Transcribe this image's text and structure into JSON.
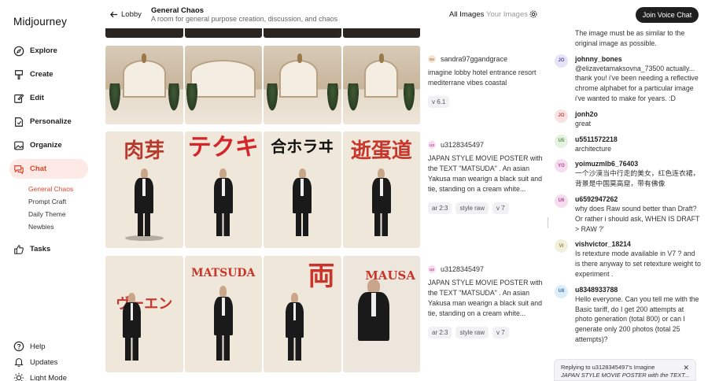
{
  "sidebar": {
    "logo": "Midjourney",
    "items": [
      {
        "label": "Explore",
        "icon": "compass-icon"
      },
      {
        "label": "Create",
        "icon": "paintbrush-icon"
      },
      {
        "label": "Edit",
        "icon": "edit-icon"
      },
      {
        "label": "Personalize",
        "icon": "personalize-icon"
      },
      {
        "label": "Organize",
        "icon": "image-icon"
      },
      {
        "label": "Chat",
        "icon": "chat-icon"
      },
      {
        "label": "Tasks",
        "icon": "thumbs-up-icon"
      }
    ],
    "chat_rooms": [
      "General Chaos",
      "Prompt Craft",
      "Daily Theme",
      "Newbies"
    ],
    "active_room": "General Chaos",
    "bottom": [
      {
        "label": "Help",
        "icon": "help-icon"
      },
      {
        "label": "Updates",
        "icon": "bell-icon"
      },
      {
        "label": "Light Mode",
        "icon": "sun-icon"
      }
    ]
  },
  "header": {
    "back_label": "Lobby",
    "room_title": "General Chaos",
    "room_subtitle": "A room for general purpose creation, discussion, and chaos",
    "tab_all": "All Images",
    "tab_your": "Your Images",
    "join_voice": "Join Voice Chat"
  },
  "posts": [
    {
      "avatar": "SA",
      "avatar_color": "#f3e6d4",
      "user": "sandra97ggandgrace",
      "prompt": "imagine lobby hotel entrance resort mediterrane vibes coastal",
      "tags": [
        "v 6.1"
      ]
    },
    {
      "avatar": "U3",
      "avatar_color": "#f6dcef",
      "user": "u3128345497",
      "prompt": "JAPAN STYLE MOVIE POSTER with the TEXT \"MATSUDA\" . An asian Yakusa man wearign a black suit and tie, standing on a cream white...",
      "tags": [
        "ar 2:3",
        "style raw",
        "v 7"
      ],
      "poster_text": [
        "肉芽",
        "テクキ",
        "合ホラヰ",
        "逝蛋道"
      ]
    },
    {
      "avatar": "U3",
      "avatar_color": "#f6dcef",
      "user": "u3128345497",
      "prompt": "JAPAN STYLE MOVIE POSTER with the TEXT \"MATSUDA\" . An asian Yakusa man wearign a black suit and tie, standing on a cream white...",
      "tags": [
        "ar 2:3",
        "style raw",
        "v 7"
      ],
      "poster_text": [
        "ヴーエン",
        "MATSUDA",
        "両",
        "MAUSA"
      ]
    }
  ],
  "chat": {
    "messages": [
      {
        "avatar": "",
        "color": "#dff3e4",
        "name": "",
        "text": "The image must be as similar to the original image as possible."
      },
      {
        "avatar": "JO",
        "color": "#e6e3f6",
        "name": "johnny_bones",
        "text": "@elizavetamaksovna_73500 actually... thank you! i've been needing a reflective chrome alphabet for a particular image i've wanted to make for years. :D"
      },
      {
        "avatar": "JO",
        "color": "#f9e1e1",
        "name": "jonh2o",
        "text": "great"
      },
      {
        "avatar": "U5",
        "color": "#e4f2df",
        "name": "u5511572218",
        "text": "architecture"
      },
      {
        "avatar": "YO",
        "color": "#f6dcef",
        "name": "yoimuzmlb6_76403",
        "text": "一个沙漠当中行走的美女，红色连衣裙，背景是中国莫高窟，带有佛像"
      },
      {
        "avatar": "U6",
        "color": "#f6dcef",
        "name": "u6592947262",
        "text": "why does Raw sound better than Draft? Or rather i should ask, WHEN IS DRAFT > RAW ?'"
      },
      {
        "avatar": "VI",
        "color": "#f2f0dc",
        "name": "vishvictor_18214",
        "text": "Is retexture mode available in V7 ? and is there anyway to set retexture weight to experiment ."
      },
      {
        "avatar": "U8",
        "color": "#ddeefa",
        "name": "u8348933788",
        "text": "Hello everyone. Can you tell me with the Basic tariff, do I get 200 attempts at photo generation (total 800) or can I generate only 200 photos (total 25 attempts)?"
      }
    ],
    "reply": {
      "label": "Replying to u3128345497's Imagine",
      "preview": "JAPAN STYLE MOVIE POSTER with the TEXT..."
    }
  }
}
